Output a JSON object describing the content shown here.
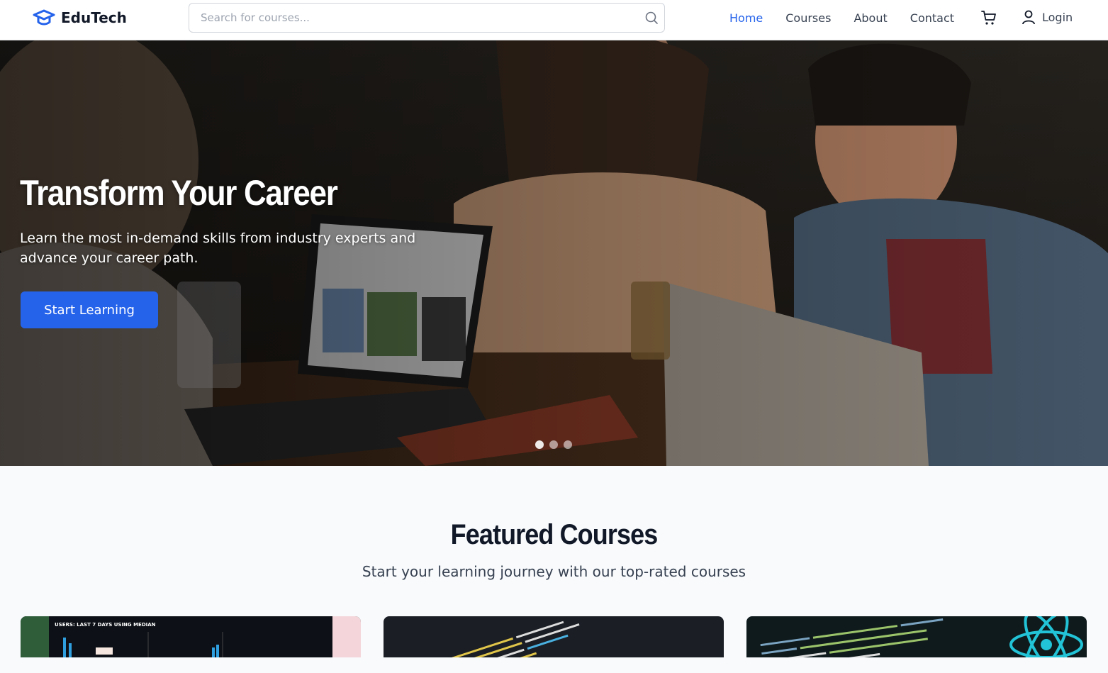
{
  "header": {
    "logo_text": "EduTech",
    "search_placeholder": "Search for courses...",
    "nav": [
      {
        "label": "Home",
        "active": true
      },
      {
        "label": "Courses",
        "active": false
      },
      {
        "label": "About",
        "active": false
      },
      {
        "label": "Contact",
        "active": false
      }
    ],
    "login_label": "Login"
  },
  "hero": {
    "title": "Transform Your Career",
    "subtitle": "Learn the most in-demand skills from industry experts and advance your career path.",
    "cta_label": "Start Learning",
    "slides_count": 3,
    "active_slide": 0
  },
  "featured": {
    "title": "Featured Courses",
    "subtitle": "Start your learning journey with our top-rated courses",
    "cards": [
      {
        "thumb_text": "USERS: LAST 7 DAYS USING MEDIAN"
      },
      {
        "thumb_text": ""
      },
      {
        "thumb_text": ""
      }
    ]
  },
  "colors": {
    "accent": "#2563eb",
    "page_bg": "#f8fafc"
  }
}
